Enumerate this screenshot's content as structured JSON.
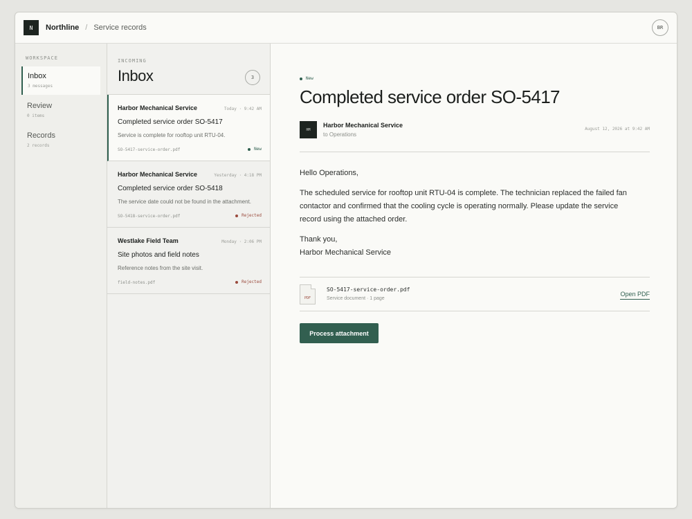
{
  "app": {
    "logo_letter": "N",
    "brand": "Northline",
    "breadcrumb_sep": "/",
    "breadcrumb": "Service records",
    "user_initials": "BR"
  },
  "sidebar": {
    "section": "WORKSPACE",
    "items": [
      {
        "label": "Inbox",
        "meta": "3 messages",
        "active": true
      },
      {
        "label": "Review",
        "meta": "0 items",
        "active": false
      },
      {
        "label": "Records",
        "meta": "2 records",
        "active": false
      }
    ]
  },
  "list": {
    "section": "INCOMING",
    "title": "Inbox",
    "count": "3",
    "messages": [
      {
        "sender": "Harbor Mechanical Service",
        "time": "Today · 9:42 AM",
        "subject": "Completed service order SO-5417",
        "preview": "Service is complete for rooftop unit RTU-04.",
        "file": "SO-5417-service-order.pdf",
        "status": "New"
      },
      {
        "sender": "Harbor Mechanical Service",
        "time": "Yesterday · 4:18 PM",
        "subject": "Completed service order SO-5418",
        "preview": "The service date could not be found in the attachment.",
        "file": "SO-5418-service-order.pdf",
        "status": "Rejected"
      },
      {
        "sender": "Westlake Field Team",
        "time": "Monday · 2:06 PM",
        "subject": "Site photos and field notes",
        "preview": "Reference notes from the site visit.",
        "file": "field-notes.pdf",
        "status": "Rejected"
      }
    ]
  },
  "detail": {
    "tag": "New",
    "title": "Completed service order SO-5417",
    "avatar_initials": "HM",
    "from": "Harbor Mechanical Service",
    "to": "to Operations",
    "date": "August 12, 2026 at 9:42 AM",
    "greeting": "Hello Operations,",
    "paragraph": "The scheduled service for rooftop unit RTU-04 is complete. The technician replaced the failed fan contactor and confirmed that the cooling cycle is operating normally. Please update the service record using the attached order.",
    "thanks": "Thank you,",
    "signature": "Harbor Mechanical Service",
    "attachment": {
      "icon_label": "PDF",
      "name": "SO-5417-service-order.pdf",
      "meta": "Service document · 1 page",
      "open_label": "Open PDF"
    },
    "action_label": "Process attachment"
  },
  "colors": {
    "accent": "#2f5f4f",
    "rejected": "#9a4a3c",
    "dark": "#1d2420"
  }
}
